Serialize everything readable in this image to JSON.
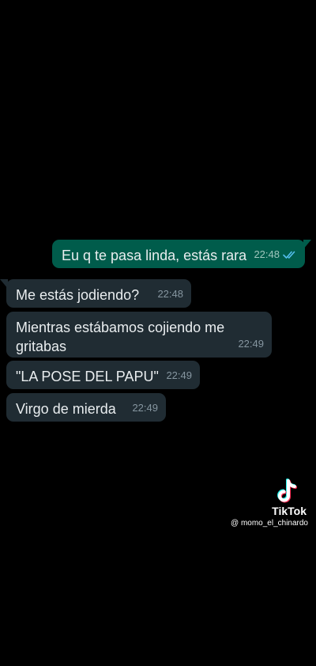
{
  "messages": [
    {
      "direction": "out",
      "text": "Eu q te pasa linda, estás rara",
      "time": "22:48",
      "status": "read"
    },
    {
      "direction": "in",
      "text": "Me estás jodiendo?",
      "time": "22:48"
    },
    {
      "direction": "in",
      "text": "Mientras estábamos cojiendo me gritabas",
      "time": "22:49"
    },
    {
      "direction": "in",
      "text": "\"LA POSE DEL PAPU\"",
      "time": "22:49"
    },
    {
      "direction": "in",
      "text": "Virgo de mierda",
      "time": "22:49"
    }
  ],
  "watermark": {
    "brand": "TikTok",
    "handle": "@ momo_el_chinardo",
    "icon": "tiktok-logo-icon"
  },
  "colors": {
    "background": "#000000",
    "outgoing_bubble": "#005c4b",
    "incoming_bubble": "#202c33",
    "read_ticks": "#53bdeb"
  }
}
